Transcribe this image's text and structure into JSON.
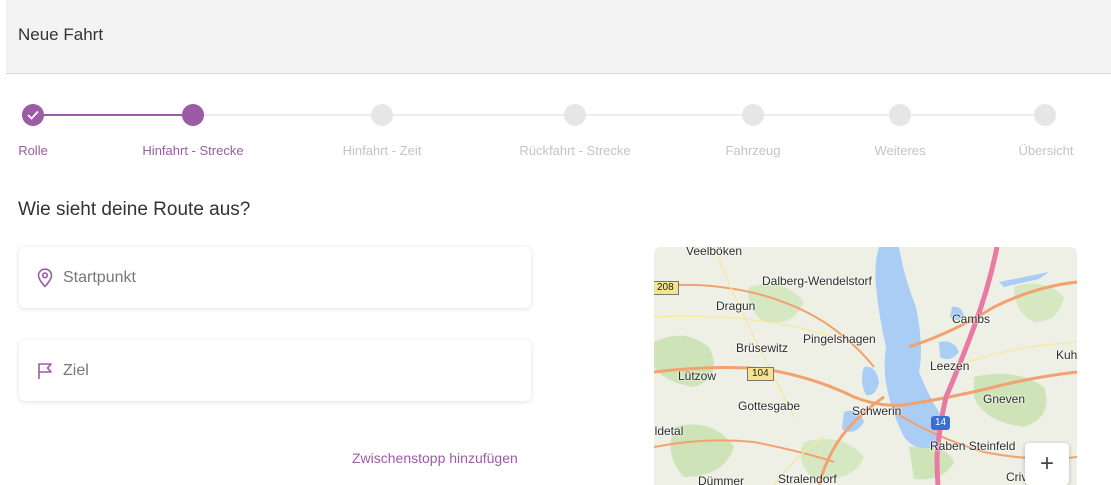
{
  "header": {
    "title": "Neue Fahrt"
  },
  "stepper": {
    "steps": [
      {
        "label": "Rolle",
        "state": "completed"
      },
      {
        "label": "Hinfahrt - Strecke",
        "state": "current"
      },
      {
        "label": "Hinfahrt - Zeit",
        "state": "pending"
      },
      {
        "label": "Rückfahrt - Strecke",
        "state": "pending"
      },
      {
        "label": "Fahrzeug",
        "state": "pending"
      },
      {
        "label": "Weiteres",
        "state": "pending"
      },
      {
        "label": "Übersicht",
        "state": "pending"
      }
    ]
  },
  "main": {
    "question": "Wie sieht deine Route aus?",
    "start": {
      "placeholder": "Startpunkt",
      "value": "",
      "icon": "location-pin-icon"
    },
    "destination": {
      "placeholder": "Ziel",
      "value": "",
      "icon": "flag-icon"
    },
    "add_stop_label": "Zwischenstopp hinzufügen"
  },
  "map": {
    "labels": {
      "veelboeken": "Veelböken",
      "dalberg": "Dalberg-Wendelstorf",
      "dragun": "Dragun",
      "cambs": "Cambs",
      "pingelshagen": "Pingelshagen",
      "bruesewitz": "Brüsewitz",
      "kuh": "Kuh",
      "luetzow": "Lützow",
      "leezen": "Leezen",
      "gottesgabe": "Gottesgabe",
      "schwerin": "Schwerin",
      "gneven": "Gneven",
      "ildetal": "ildetal",
      "raben_steinfeld": "Raben Steinfeld",
      "duemmer": "Dümmer",
      "stralendorf": "Stralendorf",
      "criv": "Criv"
    },
    "shields": {
      "b208": "208",
      "b104": "104",
      "a14": "14"
    },
    "zoom_in_label": "+"
  },
  "colors": {
    "accent": "#9b5ba5",
    "inactive": "#e6e6e6",
    "water": "#a9cdf5",
    "forest": "#cfe3b8"
  }
}
